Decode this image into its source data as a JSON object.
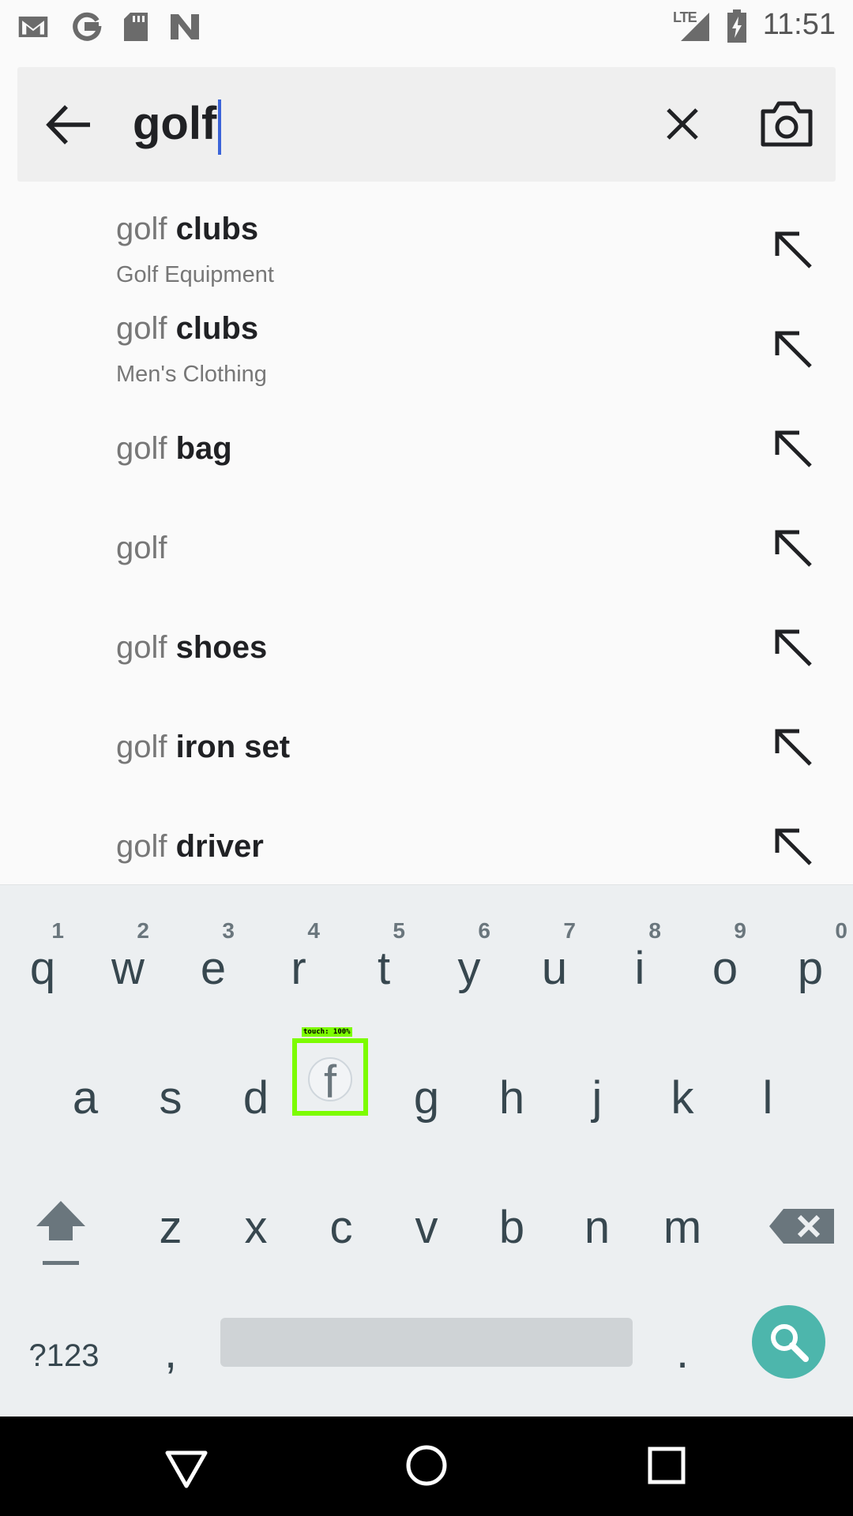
{
  "status_bar": {
    "time": "11:51",
    "network": "LTE",
    "icons": [
      "gmail-icon",
      "google-icon",
      "sd-card-icon",
      "n-icon",
      "signal-icon",
      "battery-charging-icon"
    ]
  },
  "search": {
    "query": "golf",
    "icons": [
      "back-arrow-icon",
      "clear-icon",
      "camera-icon"
    ]
  },
  "suggestions": [
    {
      "prefix": "golf",
      "completion": " clubs",
      "category": "Golf Equipment"
    },
    {
      "prefix": "golf",
      "completion": " clubs",
      "category": "Men's Clothing"
    },
    {
      "prefix": "golf",
      "completion": " bag",
      "category": ""
    },
    {
      "prefix": "golf",
      "completion": "",
      "category": ""
    },
    {
      "prefix": "golf",
      "completion": " shoes",
      "category": ""
    },
    {
      "prefix": "golf",
      "completion": " iron set",
      "category": ""
    },
    {
      "prefix": "golf",
      "completion": " driver",
      "category": ""
    }
  ],
  "keyboard": {
    "row1": [
      {
        "ch": "q",
        "digit": "1"
      },
      {
        "ch": "w",
        "digit": "2"
      },
      {
        "ch": "e",
        "digit": "3"
      },
      {
        "ch": "r",
        "digit": "4"
      },
      {
        "ch": "t",
        "digit": "5"
      },
      {
        "ch": "y",
        "digit": "6"
      },
      {
        "ch": "u",
        "digit": "7"
      },
      {
        "ch": "i",
        "digit": "8"
      },
      {
        "ch": "o",
        "digit": "9"
      },
      {
        "ch": "p",
        "digit": "0"
      }
    ],
    "row2": [
      "a",
      "s",
      "d",
      "f",
      "g",
      "h",
      "j",
      "k",
      "l"
    ],
    "row3": [
      "z",
      "x",
      "c",
      "v",
      "b",
      "n",
      "m"
    ],
    "symbols_label": "?123",
    "comma": ",",
    "period": ".",
    "touch_label": "touch: 100%",
    "search_button_color": "#4db6ac",
    "touch_highlight_color": "#7cfc00"
  },
  "nav_bar": {
    "icons": [
      "back-triangle-icon",
      "home-circle-icon",
      "recents-square-icon"
    ]
  }
}
